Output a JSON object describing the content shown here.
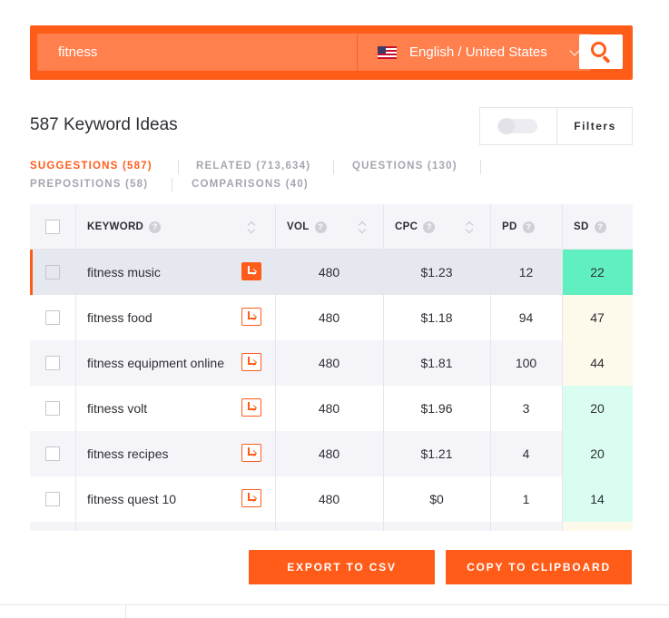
{
  "search": {
    "query": "fitness",
    "language": "English / United States"
  },
  "header": {
    "title": "587 Keyword Ideas",
    "filters_label": "Filters"
  },
  "tabs": [
    {
      "label": "SUGGESTIONS (587)",
      "active": true
    },
    {
      "label": "RELATED (713,634)",
      "active": false
    },
    {
      "label": "QUESTIONS (130)",
      "active": false
    },
    {
      "label": "PREPOSITIONS (58)",
      "active": false
    },
    {
      "label": "COMPARISONS (40)",
      "active": false
    }
  ],
  "table": {
    "columns": [
      "KEYWORD",
      "VOL",
      "CPC",
      "PD",
      "SD"
    ],
    "help_glyph": "?",
    "rows": [
      {
        "keyword": "fitness music",
        "vol": "480",
        "cpc": "$1.23",
        "pd": "12",
        "sd": "22"
      },
      {
        "keyword": "fitness food",
        "vol": "480",
        "cpc": "$1.18",
        "pd": "94",
        "sd": "47"
      },
      {
        "keyword": "fitness equipment online",
        "vol": "480",
        "cpc": "$1.81",
        "pd": "100",
        "sd": "44"
      },
      {
        "keyword": "fitness volt",
        "vol": "480",
        "cpc": "$1.96",
        "pd": "3",
        "sd": "20"
      },
      {
        "keyword": "fitness recipes",
        "vol": "480",
        "cpc": "$1.21",
        "pd": "4",
        "sd": "20"
      },
      {
        "keyword": "fitness quest 10",
        "vol": "480",
        "cpc": "$0",
        "pd": "1",
        "sd": "14"
      }
    ]
  },
  "actions": {
    "export_label": "EXPORT TO CSV",
    "copy_label": "COPY TO CLIPBOARD"
  },
  "colors": {
    "accent": "#ff5c1a",
    "sd_easy": "#60efc0",
    "sd_easy_light": "#d9fdf0",
    "sd_medium": "#fefaeb"
  }
}
